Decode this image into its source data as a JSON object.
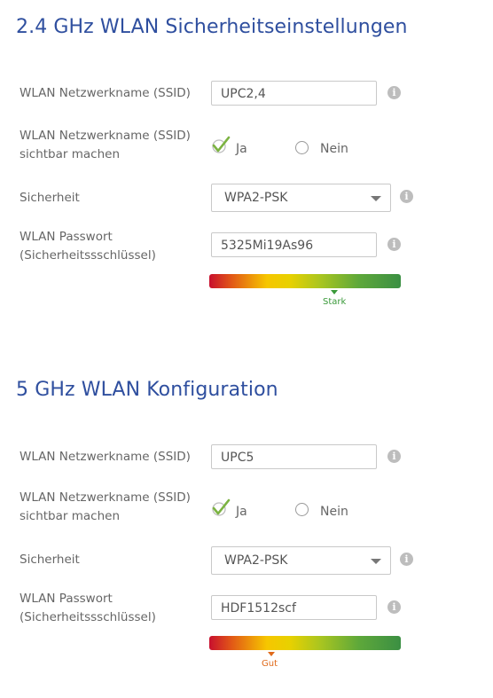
{
  "sections": [
    {
      "title": "2.4 GHz WLAN Sicherheitseinstellungen",
      "ssid_label": "WLAN Netzwerkname (SSID)",
      "ssid_value": "UPC2,4",
      "visible_label_line1": "WLAN Netzwerkname (SSID)",
      "visible_label_line2": "sichtbar machen",
      "yes_label": "Ja",
      "no_label": "Nein",
      "visible_selected": "Ja",
      "security_label": "Sicherheit",
      "security_value": "WPA2-PSK",
      "password_label_line1": "WLAN Passwort",
      "password_label_line2": "(Sicherheitssschlüssel)",
      "password_value": "5325Mi19As96",
      "strength_text": "Stark",
      "strength_level": 0.65,
      "strength_color": "#3b9a3b"
    },
    {
      "title": "5 GHz WLAN Konfiguration",
      "ssid_label": "WLAN Netzwerkname (SSID)",
      "ssid_value": "UPC5",
      "visible_label_line1": "WLAN Netzwerkname (SSID)",
      "visible_label_line2": "sichtbar machen",
      "yes_label": "Ja",
      "no_label": "Nein",
      "visible_selected": "Ja",
      "security_label": "Sicherheit",
      "security_value": "WPA2-PSK",
      "password_label_line1": "WLAN Passwort",
      "password_label_line2": "(Sicherheitssschlüssel)",
      "password_value": "HDF1512scf",
      "strength_text": "Gut",
      "strength_level": 0.33,
      "strength_color": "#e06a1a"
    }
  ],
  "colors": {
    "title": "#2f4f9f",
    "check": "#7cb342",
    "info_icon": "#bdbdbd"
  }
}
